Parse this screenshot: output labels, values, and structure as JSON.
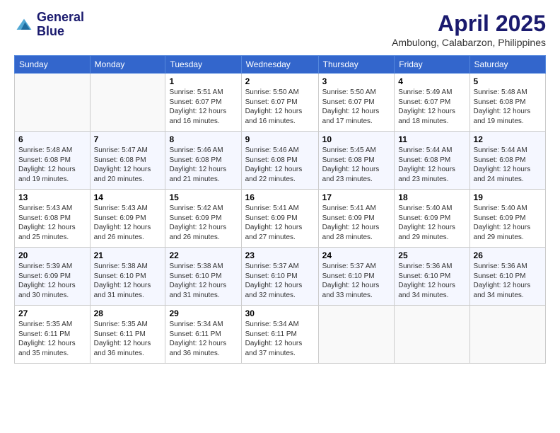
{
  "header": {
    "logo_line1": "General",
    "logo_line2": "Blue",
    "month_title": "April 2025",
    "location": "Ambulong, Calabarzon, Philippines"
  },
  "days_of_week": [
    "Sunday",
    "Monday",
    "Tuesday",
    "Wednesday",
    "Thursday",
    "Friday",
    "Saturday"
  ],
  "weeks": [
    [
      {
        "day": "",
        "empty": true
      },
      {
        "day": "",
        "empty": true
      },
      {
        "day": "1",
        "sunrise": "5:51 AM",
        "sunset": "6:07 PM",
        "daylight": "12 hours and 16 minutes."
      },
      {
        "day": "2",
        "sunrise": "5:50 AM",
        "sunset": "6:07 PM",
        "daylight": "12 hours and 16 minutes."
      },
      {
        "day": "3",
        "sunrise": "5:50 AM",
        "sunset": "6:07 PM",
        "daylight": "12 hours and 17 minutes."
      },
      {
        "day": "4",
        "sunrise": "5:49 AM",
        "sunset": "6:07 PM",
        "daylight": "12 hours and 18 minutes."
      },
      {
        "day": "5",
        "sunrise": "5:48 AM",
        "sunset": "6:08 PM",
        "daylight": "12 hours and 19 minutes."
      }
    ],
    [
      {
        "day": "6",
        "sunrise": "5:48 AM",
        "sunset": "6:08 PM",
        "daylight": "12 hours and 19 minutes."
      },
      {
        "day": "7",
        "sunrise": "5:47 AM",
        "sunset": "6:08 PM",
        "daylight": "12 hours and 20 minutes."
      },
      {
        "day": "8",
        "sunrise": "5:46 AM",
        "sunset": "6:08 PM",
        "daylight": "12 hours and 21 minutes."
      },
      {
        "day": "9",
        "sunrise": "5:46 AM",
        "sunset": "6:08 PM",
        "daylight": "12 hours and 22 minutes."
      },
      {
        "day": "10",
        "sunrise": "5:45 AM",
        "sunset": "6:08 PM",
        "daylight": "12 hours and 23 minutes."
      },
      {
        "day": "11",
        "sunrise": "5:44 AM",
        "sunset": "6:08 PM",
        "daylight": "12 hours and 23 minutes."
      },
      {
        "day": "12",
        "sunrise": "5:44 AM",
        "sunset": "6:08 PM",
        "daylight": "12 hours and 24 minutes."
      }
    ],
    [
      {
        "day": "13",
        "sunrise": "5:43 AM",
        "sunset": "6:08 PM",
        "daylight": "12 hours and 25 minutes."
      },
      {
        "day": "14",
        "sunrise": "5:43 AM",
        "sunset": "6:09 PM",
        "daylight": "12 hours and 26 minutes."
      },
      {
        "day": "15",
        "sunrise": "5:42 AM",
        "sunset": "6:09 PM",
        "daylight": "12 hours and 26 minutes."
      },
      {
        "day": "16",
        "sunrise": "5:41 AM",
        "sunset": "6:09 PM",
        "daylight": "12 hours and 27 minutes."
      },
      {
        "day": "17",
        "sunrise": "5:41 AM",
        "sunset": "6:09 PM",
        "daylight": "12 hours and 28 minutes."
      },
      {
        "day": "18",
        "sunrise": "5:40 AM",
        "sunset": "6:09 PM",
        "daylight": "12 hours and 29 minutes."
      },
      {
        "day": "19",
        "sunrise": "5:40 AM",
        "sunset": "6:09 PM",
        "daylight": "12 hours and 29 minutes."
      }
    ],
    [
      {
        "day": "20",
        "sunrise": "5:39 AM",
        "sunset": "6:09 PM",
        "daylight": "12 hours and 30 minutes."
      },
      {
        "day": "21",
        "sunrise": "5:38 AM",
        "sunset": "6:10 PM",
        "daylight": "12 hours and 31 minutes."
      },
      {
        "day": "22",
        "sunrise": "5:38 AM",
        "sunset": "6:10 PM",
        "daylight": "12 hours and 31 minutes."
      },
      {
        "day": "23",
        "sunrise": "5:37 AM",
        "sunset": "6:10 PM",
        "daylight": "12 hours and 32 minutes."
      },
      {
        "day": "24",
        "sunrise": "5:37 AM",
        "sunset": "6:10 PM",
        "daylight": "12 hours and 33 minutes."
      },
      {
        "day": "25",
        "sunrise": "5:36 AM",
        "sunset": "6:10 PM",
        "daylight": "12 hours and 34 minutes."
      },
      {
        "day": "26",
        "sunrise": "5:36 AM",
        "sunset": "6:10 PM",
        "daylight": "12 hours and 34 minutes."
      }
    ],
    [
      {
        "day": "27",
        "sunrise": "5:35 AM",
        "sunset": "6:11 PM",
        "daylight": "12 hours and 35 minutes."
      },
      {
        "day": "28",
        "sunrise": "5:35 AM",
        "sunset": "6:11 PM",
        "daylight": "12 hours and 36 minutes."
      },
      {
        "day": "29",
        "sunrise": "5:34 AM",
        "sunset": "6:11 PM",
        "daylight": "12 hours and 36 minutes."
      },
      {
        "day": "30",
        "sunrise": "5:34 AM",
        "sunset": "6:11 PM",
        "daylight": "12 hours and 37 minutes."
      },
      {
        "day": "",
        "empty": true
      },
      {
        "day": "",
        "empty": true
      },
      {
        "day": "",
        "empty": true
      }
    ]
  ]
}
